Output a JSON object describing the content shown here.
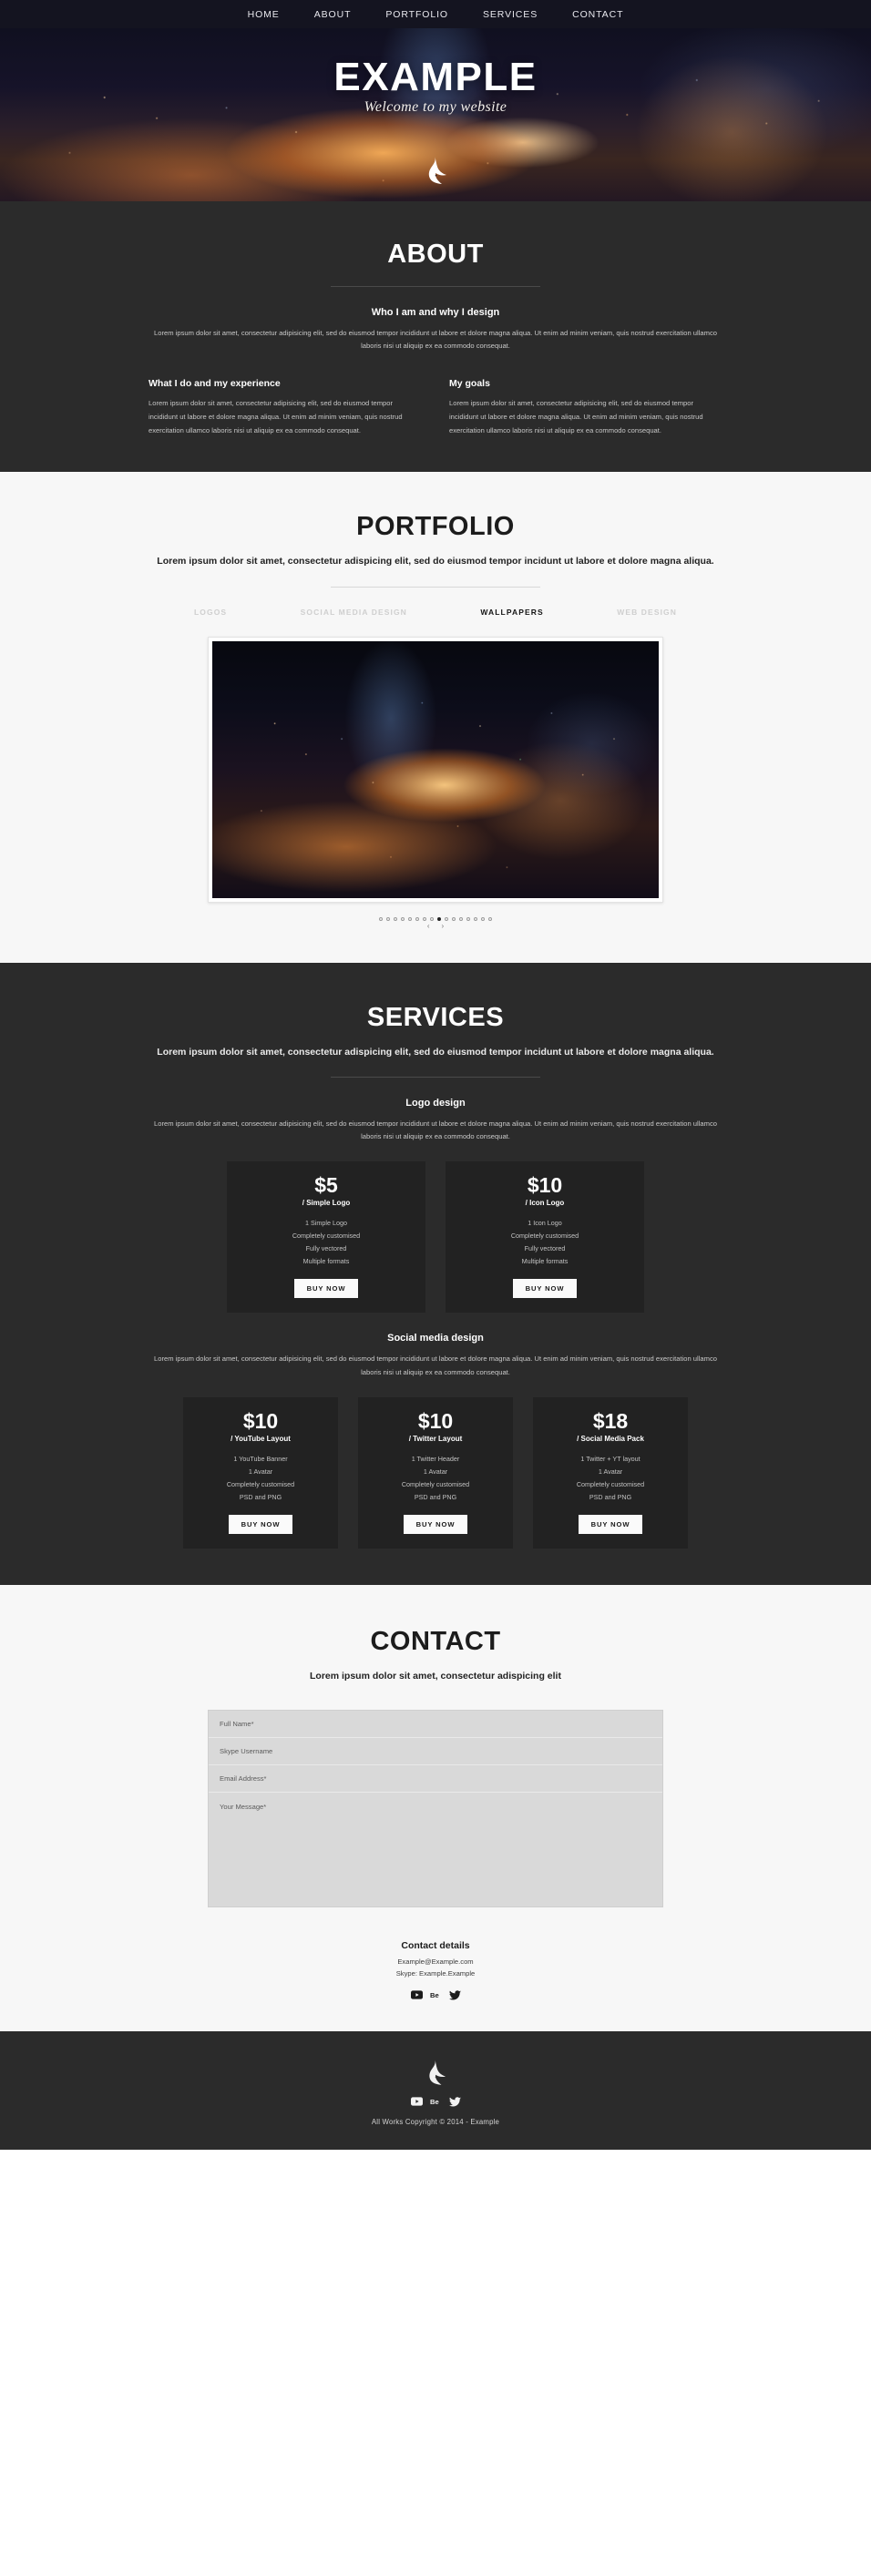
{
  "nav": {
    "items": [
      {
        "label": "HOME"
      },
      {
        "label": "ABOUT"
      },
      {
        "label": "PORTFOLIO"
      },
      {
        "label": "SERVICES"
      },
      {
        "label": "CONTACT"
      }
    ]
  },
  "hero": {
    "title": "EXAMPLE",
    "subtitle": "Welcome to my website",
    "logo_icon": "brand-l-logo-icon"
  },
  "about": {
    "title": "ABOUT",
    "block_title": "Who I am and why I design",
    "block_copy": "Lorem ipsum dolor sit amet, consectetur adipisicing elit, sed do eiusmod tempor incididunt ut labore et dolore magna aliqua. Ut enim ad minim veniam, quis nostrud exercitation ullamco laboris nisi ut aliquip ex ea commodo consequat.",
    "columns": [
      {
        "title": "What I do and my experience",
        "copy": "Lorem ipsum dolor sit amet, consectetur adipisicing elit, sed do eiusmod tempor incididunt ut labore et dolore magna aliqua. Ut enim ad minim veniam, quis nostrud exercitation ullamco laboris nisi ut aliquip ex ea commodo consequat."
      },
      {
        "title": "My goals",
        "copy": "Lorem ipsum dolor sit amet, consectetur adipisicing elit, sed do eiusmod tempor incididunt ut labore et dolore magna aliqua. Ut enim ad minim veniam, quis nostrud exercitation ullamco laboris nisi ut aliquip ex ea commodo consequat."
      }
    ]
  },
  "portfolio": {
    "title": "PORTFOLIO",
    "lead": "Lorem ipsum dolor sit amet, consectetur adispicing elit, sed do eiusmod tempor incidunt ut labore et dolore magna aliqua.",
    "filters": [
      {
        "label": "LOGOS",
        "active": false
      },
      {
        "label": "SOCIAL MEDIA DESIGN",
        "active": false
      },
      {
        "label": "WALLPAPERS",
        "active": true
      },
      {
        "label": "WEB DESIGN",
        "active": false
      }
    ],
    "slide_alt": "night-city-light-trails-wallpaper",
    "carousel": {
      "total_dots": 16,
      "active_index": 8,
      "prev_icon": "chevron-left-icon",
      "next_icon": "chevron-right-icon"
    }
  },
  "services": {
    "title": "SERVICES",
    "lead": "Lorem ipsum dolor sit amet, consectetur adispicing elit, sed do eiusmod tempor incidunt ut labore et dolore magna aliqua.",
    "groups": [
      {
        "title": "Logo design",
        "copy": "Lorem ipsum dolor sit amet, consectetur adipisicing elit, sed do eiusmod tempor incididunt ut labore et dolore magna aliqua. Ut enim ad minim veniam, quis nostrud exercitation ullamco laboris nisi ut aliquip ex ea commodo consequat.",
        "cards": [
          {
            "price": "$5",
            "plan": "/ Simple Logo",
            "features": [
              "1 Simple Logo",
              "Completely customised",
              "Fully vectored",
              "Multiple formats"
            ],
            "button": "BUY NOW"
          },
          {
            "price": "$10",
            "plan": "/ Icon Logo",
            "features": [
              "1 Icon Logo",
              "Completely customised",
              "Fully vectored",
              "Multiple formats"
            ],
            "button": "BUY NOW"
          }
        ]
      },
      {
        "title": "Social media design",
        "copy": "Lorem ipsum dolor sit amet, consectetur adipisicing elit, sed do eiusmod tempor incididunt ut labore et dolore magna aliqua. Ut enim ad minim veniam, quis nostrud exercitation ullamco laboris nisi ut aliquip ex ea commodo consequat.",
        "cards": [
          {
            "price": "$10",
            "plan": "/ YouTube Layout",
            "features": [
              "1 YouTube Banner",
              "1 Avatar",
              "Completely customised",
              "PSD and PNG"
            ],
            "button": "BUY NOW"
          },
          {
            "price": "$10",
            "plan": "/ Twitter Layout",
            "features": [
              "1 Twitter Header",
              "1 Avatar",
              "Completely customised",
              "PSD and PNG"
            ],
            "button": "BUY NOW"
          },
          {
            "price": "$18",
            "plan": "/ Social Media Pack",
            "features": [
              "1 Twitter + YT layout",
              "1 Avatar",
              "Completely customised",
              "PSD and PNG"
            ],
            "button": "BUY NOW"
          }
        ]
      }
    ]
  },
  "contact": {
    "title": "CONTACT",
    "lead": "Lorem ipsum dolor sit amet, consectetur adispicing elit",
    "form": {
      "full_name_placeholder": "Full Name*",
      "full_name_value": "",
      "skype_placeholder": "Skype Username",
      "skype_value": "",
      "email_placeholder": "Email Address*",
      "email_value": "",
      "message_placeholder": "Your Message*",
      "message_value": ""
    },
    "details": {
      "title": "Contact details",
      "email": "Example@Example.com",
      "skype": "Skype: Example.Example"
    },
    "socials": [
      {
        "name": "youtube-icon"
      },
      {
        "name": "behance-icon"
      },
      {
        "name": "twitter-icon"
      }
    ]
  },
  "footer": {
    "logo_icon": "brand-l-logo-icon",
    "socials": [
      {
        "name": "youtube-icon"
      },
      {
        "name": "behance-icon"
      },
      {
        "name": "twitter-icon"
      }
    ],
    "copyright": "All Works Copyright © 2014 - Example"
  },
  "colors": {
    "nav_bg": "#141420",
    "dark_section": "#2b2b2b",
    "light_section": "#f7f7f7",
    "card_bg": "#222222",
    "form_bg": "#d9d9d9"
  }
}
